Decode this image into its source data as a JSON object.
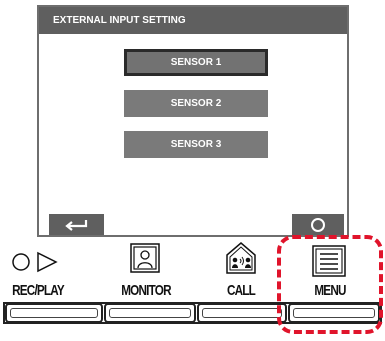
{
  "screen": {
    "title": "EXTERNAL INPUT SETTING",
    "sensors": [
      {
        "label": "SENSOR 1",
        "selected": true
      },
      {
        "label": "SENSOR 2",
        "selected": false
      },
      {
        "label": "SENSOR 3",
        "selected": false
      }
    ],
    "back_icon": "return-arrow-icon",
    "ok_icon": "circle-icon"
  },
  "hardware_buttons": [
    {
      "label": "REC/PLAY",
      "icon": "record-play-icon"
    },
    {
      "label": "MONITOR",
      "icon": "monitor-person-icon"
    },
    {
      "label": "CALL",
      "icon": "call-house-icon"
    },
    {
      "label": "MENU",
      "icon": "menu-list-icon"
    }
  ],
  "colors": {
    "screen_header": "#5f5f5f",
    "button_gray": "#7a7a7a",
    "highlight": "#e0142b"
  }
}
